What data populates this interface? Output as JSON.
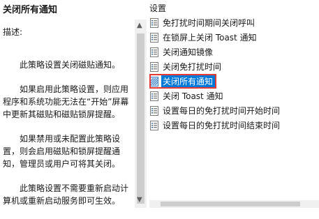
{
  "left_panel": {
    "title": "关闭所有通知",
    "description_label": "描述:",
    "description_paragraphs": [
      "此策略设置关闭磁贴通知。",
      "如果启用此策略设置，则应用程序和系统功能无法在“开始”屏幕中更新其磁贴和磁贴锁屏提醒。",
      "如果禁用或未配置此策略设置，则会启用磁贴和锁屏提醒通知，管理员或用户可将其关闭。",
      "此策略设置不需要重新启动计算机或重新启动服务即可生效。"
    ]
  },
  "right_panel": {
    "header": "设置",
    "items": [
      {
        "label": "免打扰时间期间关闭呼叫",
        "icon": "policy-setting-icon",
        "selected": false
      },
      {
        "label": "在锁屏上关闭 Toast 通知",
        "icon": "policy-setting-icon",
        "selected": false
      },
      {
        "label": "关闭通知镜像",
        "icon": "policy-setting-icon",
        "selected": false
      },
      {
        "label": "关闭免打扰时间",
        "icon": "policy-setting-icon",
        "selected": false
      },
      {
        "label": "关闭所有通知",
        "icon": "policy-setting-icon",
        "selected": true
      },
      {
        "label": "关闭 Toast 通知",
        "icon": "policy-setting-icon",
        "selected": false
      },
      {
        "label": "设置每日的免打扰时间开始时间",
        "icon": "policy-setting-icon",
        "selected": false
      },
      {
        "label": "设置每日的免打扰时间结束时间",
        "icon": "policy-setting-icon",
        "selected": false
      }
    ]
  },
  "colors": {
    "selection": "#0078d7",
    "highlight_frame": "#e53935"
  }
}
